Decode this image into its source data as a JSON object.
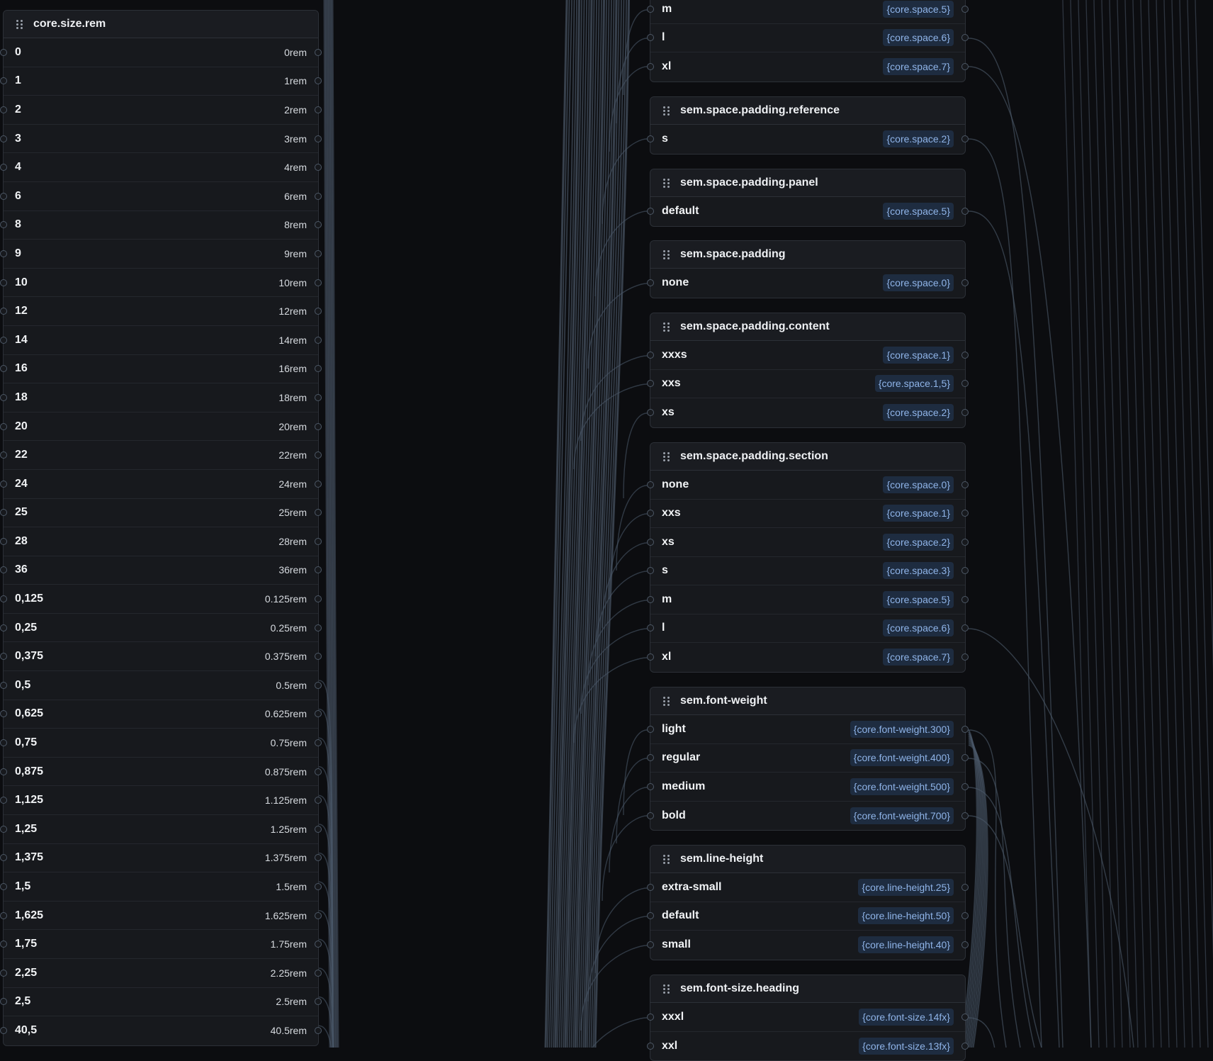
{
  "canvas": {
    "background": "#0c0d10",
    "wire_color": "#4a5767",
    "value_color": "#8fb4e8"
  },
  "core_size_rem": {
    "title": "core.size.rem",
    "rows": [
      {
        "k": "0",
        "v": "0rem"
      },
      {
        "k": "1",
        "v": "1rem"
      },
      {
        "k": "2",
        "v": "2rem"
      },
      {
        "k": "3",
        "v": "3rem"
      },
      {
        "k": "4",
        "v": "4rem"
      },
      {
        "k": "6",
        "v": "6rem"
      },
      {
        "k": "8",
        "v": "8rem"
      },
      {
        "k": "9",
        "v": "9rem"
      },
      {
        "k": "10",
        "v": "10rem"
      },
      {
        "k": "12",
        "v": "12rem"
      },
      {
        "k": "14",
        "v": "14rem"
      },
      {
        "k": "16",
        "v": "16rem"
      },
      {
        "k": "18",
        "v": "18rem"
      },
      {
        "k": "20",
        "v": "20rem"
      },
      {
        "k": "22",
        "v": "22rem"
      },
      {
        "k": "24",
        "v": "24rem"
      },
      {
        "k": "25",
        "v": "25rem"
      },
      {
        "k": "28",
        "v": "28rem"
      },
      {
        "k": "36",
        "v": "36rem"
      },
      {
        "k": "0,125",
        "v": "0.125rem"
      },
      {
        "k": "0,25",
        "v": "0.25rem"
      },
      {
        "k": "0,375",
        "v": "0.375rem"
      },
      {
        "k": "0,5",
        "v": "0.5rem"
      },
      {
        "k": "0,625",
        "v": "0.625rem"
      },
      {
        "k": "0,75",
        "v": "0.75rem"
      },
      {
        "k": "0,875",
        "v": "0.875rem"
      },
      {
        "k": "1,125",
        "v": "1.125rem"
      },
      {
        "k": "1,25",
        "v": "1.25rem"
      },
      {
        "k": "1,375",
        "v": "1.375rem"
      },
      {
        "k": "1,5",
        "v": "1.5rem"
      },
      {
        "k": "1,625",
        "v": "1.625rem"
      },
      {
        "k": "1,75",
        "v": "1.75rem"
      },
      {
        "k": "2,25",
        "v": "2.25rem"
      },
      {
        "k": "2,5",
        "v": "2.5rem"
      },
      {
        "k": "40,5",
        "v": "40.5rem"
      }
    ]
  },
  "space_top": {
    "rows": [
      {
        "k": "m",
        "v": "{core.space.5}"
      },
      {
        "k": "l",
        "v": "{core.space.6}"
      },
      {
        "k": "xl",
        "v": "{core.space.7}"
      }
    ]
  },
  "padding_reference": {
    "title": "sem.space.padding.reference",
    "rows": [
      {
        "k": "s",
        "v": "{core.space.2}"
      }
    ]
  },
  "padding_panel": {
    "title": "sem.space.padding.panel",
    "rows": [
      {
        "k": "default",
        "v": "{core.space.5}"
      }
    ]
  },
  "padding": {
    "title": "sem.space.padding",
    "rows": [
      {
        "k": "none",
        "v": "{core.space.0}"
      }
    ]
  },
  "padding_content": {
    "title": "sem.space.padding.content",
    "rows": [
      {
        "k": "xxxs",
        "v": "{core.space.1}"
      },
      {
        "k": "xxs",
        "v": "{core.space.1,5}"
      },
      {
        "k": "xs",
        "v": "{core.space.2}"
      }
    ]
  },
  "padding_section": {
    "title": "sem.space.padding.section",
    "rows": [
      {
        "k": "none",
        "v": "{core.space.0}"
      },
      {
        "k": "xxs",
        "v": "{core.space.1}"
      },
      {
        "k": "xs",
        "v": "{core.space.2}"
      },
      {
        "k": "s",
        "v": "{core.space.3}"
      },
      {
        "k": "m",
        "v": "{core.space.5}"
      },
      {
        "k": "l",
        "v": "{core.space.6}"
      },
      {
        "k": "xl",
        "v": "{core.space.7}"
      }
    ]
  },
  "font_weight": {
    "title": "sem.font-weight",
    "rows": [
      {
        "k": "light",
        "v": "{core.font-weight.300}"
      },
      {
        "k": "regular",
        "v": "{core.font-weight.400}"
      },
      {
        "k": "medium",
        "v": "{core.font-weight.500}"
      },
      {
        "k": "bold",
        "v": "{core.font-weight.700}"
      }
    ]
  },
  "line_height": {
    "title": "sem.line-height",
    "rows": [
      {
        "k": "extra-small",
        "v": "{core.line-height.25}"
      },
      {
        "k": "default",
        "v": "{core.line-height.50}"
      },
      {
        "k": "small",
        "v": "{core.line-height.40}"
      }
    ]
  },
  "font_size_heading": {
    "title": "sem.font-size.heading",
    "rows": [
      {
        "k": "xxxl",
        "v": "{core.font-size.14fx}"
      },
      {
        "k": "xxl",
        "v": "{core.font-size.13fx}"
      }
    ]
  }
}
